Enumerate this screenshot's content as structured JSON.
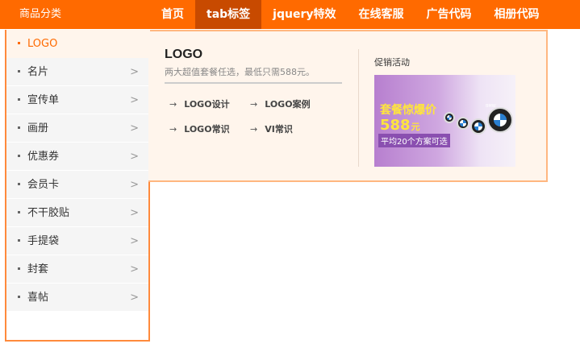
{
  "category_header": "商品分类",
  "nav": [
    {
      "label": "首页",
      "active": false
    },
    {
      "label": "tab标签",
      "active": true
    },
    {
      "label": "jquery特效",
      "active": false
    },
    {
      "label": "在线客服",
      "active": false
    },
    {
      "label": "广告代码",
      "active": false
    },
    {
      "label": "相册代码",
      "active": false
    }
  ],
  "active_category": "LOGO",
  "categories": [
    "名片",
    "宣传单",
    "画册",
    "优惠券",
    "会员卡",
    "不干胶贴",
    "手提袋",
    "封套",
    "喜帖"
  ],
  "arrow_glyph": ">",
  "panel": {
    "title": "LOGO",
    "subtitle": "两大超值套餐任选，最低只需588元。",
    "links": [
      "LOGO设计",
      "LOGO案例",
      "LOGO常识",
      "VI常识"
    ],
    "link_arrow": "→",
    "promo_title": "促销活动",
    "banner": {
      "headline": "套餐惊爆价",
      "price": "588",
      "currency": "元",
      "tagline": "平均20个方案可选",
      "brand": "BMW"
    }
  },
  "colors": {
    "accent": "#ff6a00",
    "active_nav": "#c84a00",
    "panel_bg": "#fff5ec",
    "border": "#ff8a3c"
  }
}
